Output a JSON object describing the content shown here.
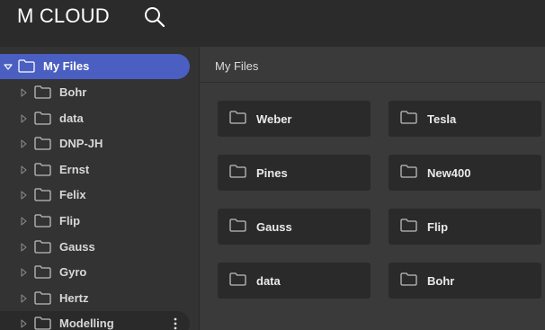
{
  "app": {
    "title": "M CLOUD"
  },
  "sidebar": {
    "root": {
      "label": "My Files"
    },
    "items": [
      {
        "label": "Bohr"
      },
      {
        "label": "data"
      },
      {
        "label": "DNP-JH"
      },
      {
        "label": "Ernst"
      },
      {
        "label": "Felix"
      },
      {
        "label": "Flip"
      },
      {
        "label": "Gauss"
      },
      {
        "label": "Gyro"
      },
      {
        "label": "Hertz"
      },
      {
        "label": "Modelling"
      }
    ]
  },
  "main": {
    "title": "My Files",
    "folders": [
      {
        "label": "Weber"
      },
      {
        "label": "Tesla"
      },
      {
        "label": "Pines"
      },
      {
        "label": "New400"
      },
      {
        "label": "Gauss"
      },
      {
        "label": "Flip"
      },
      {
        "label": "data"
      },
      {
        "label": "Bohr"
      }
    ]
  },
  "colors": {
    "accent": "#4a5fc1",
    "topbar": "#2b2b2b",
    "sidebar": "#333333",
    "main": "#3a3a3a",
    "card": "#2a2a2a"
  },
  "icons": [
    "search-icon",
    "folder-icon",
    "caret-down-icon",
    "caret-right-icon",
    "more-vert-icon"
  ]
}
